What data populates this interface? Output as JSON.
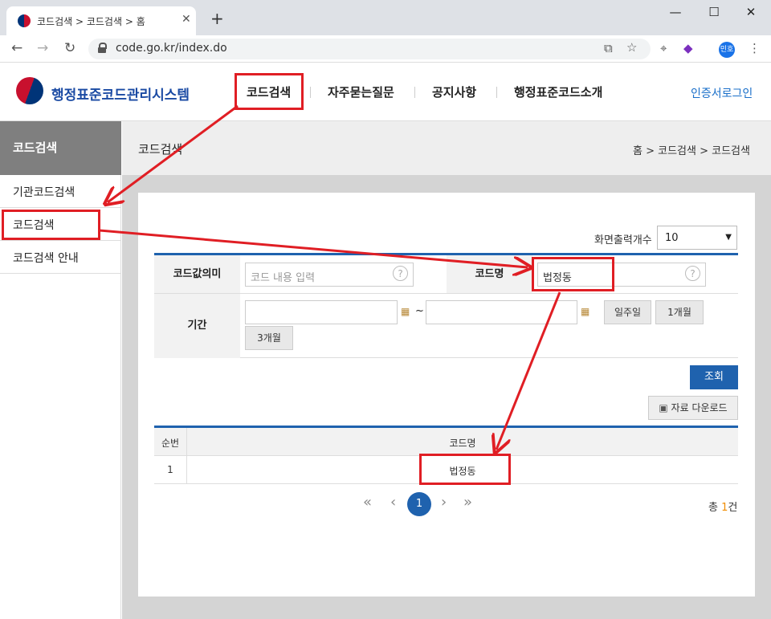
{
  "browser": {
    "tab_title": "코드검색 > 코드검색 > 홈",
    "url": "code.go.kr/index.do",
    "profile_label": "민호",
    "close_glyph": "✕",
    "newtab_glyph": "+",
    "minimize_glyph": "—",
    "maximize_glyph": "☐",
    "window_close_glyph": "✕",
    "back_glyph": "←",
    "forward_glyph": "→",
    "reload_glyph": "↻",
    "star_glyph": "☆",
    "menu_glyph": "⋮"
  },
  "site": {
    "logo_text": "행정표준코드관리시스템",
    "nav": [
      "코드검색",
      "자주묻는질문",
      "공지사항",
      "행정표준코드소개"
    ],
    "login": "인증서로그인"
  },
  "sidebar": {
    "title": "코드검색",
    "items": [
      "기관코드검색",
      "코드검색",
      "코드검색 안내"
    ]
  },
  "content": {
    "title": "코드검색",
    "breadcrumb": "홈 > 코드검색 > 코드검색"
  },
  "search": {
    "page_size_label": "화면출력개수",
    "page_size_value": "10",
    "code_meaning_label": "코드값의미",
    "code_meaning_placeholder": "코드 내용 입력",
    "code_name_label": "코드명",
    "code_name_value": "법정동",
    "period_label": "기간",
    "tilde": "~",
    "btn_week": "일주일",
    "btn_1month": "1개월",
    "btn_3month": "3개월",
    "submit": "조회",
    "download": "자료 다운로드",
    "help_glyph": "?"
  },
  "results": {
    "headers": [
      "순번",
      "코드명"
    ],
    "rows": [
      {
        "no": "1",
        "name": "법정동"
      }
    ]
  },
  "pagination": {
    "first": "«",
    "prev": "‹",
    "current": "1",
    "next": "›",
    "last": "»",
    "total_prefix": "총 ",
    "total_count": "1",
    "total_suffix": "건"
  },
  "colors": {
    "accent": "#1f62ae",
    "annotation": "#e01e24"
  }
}
